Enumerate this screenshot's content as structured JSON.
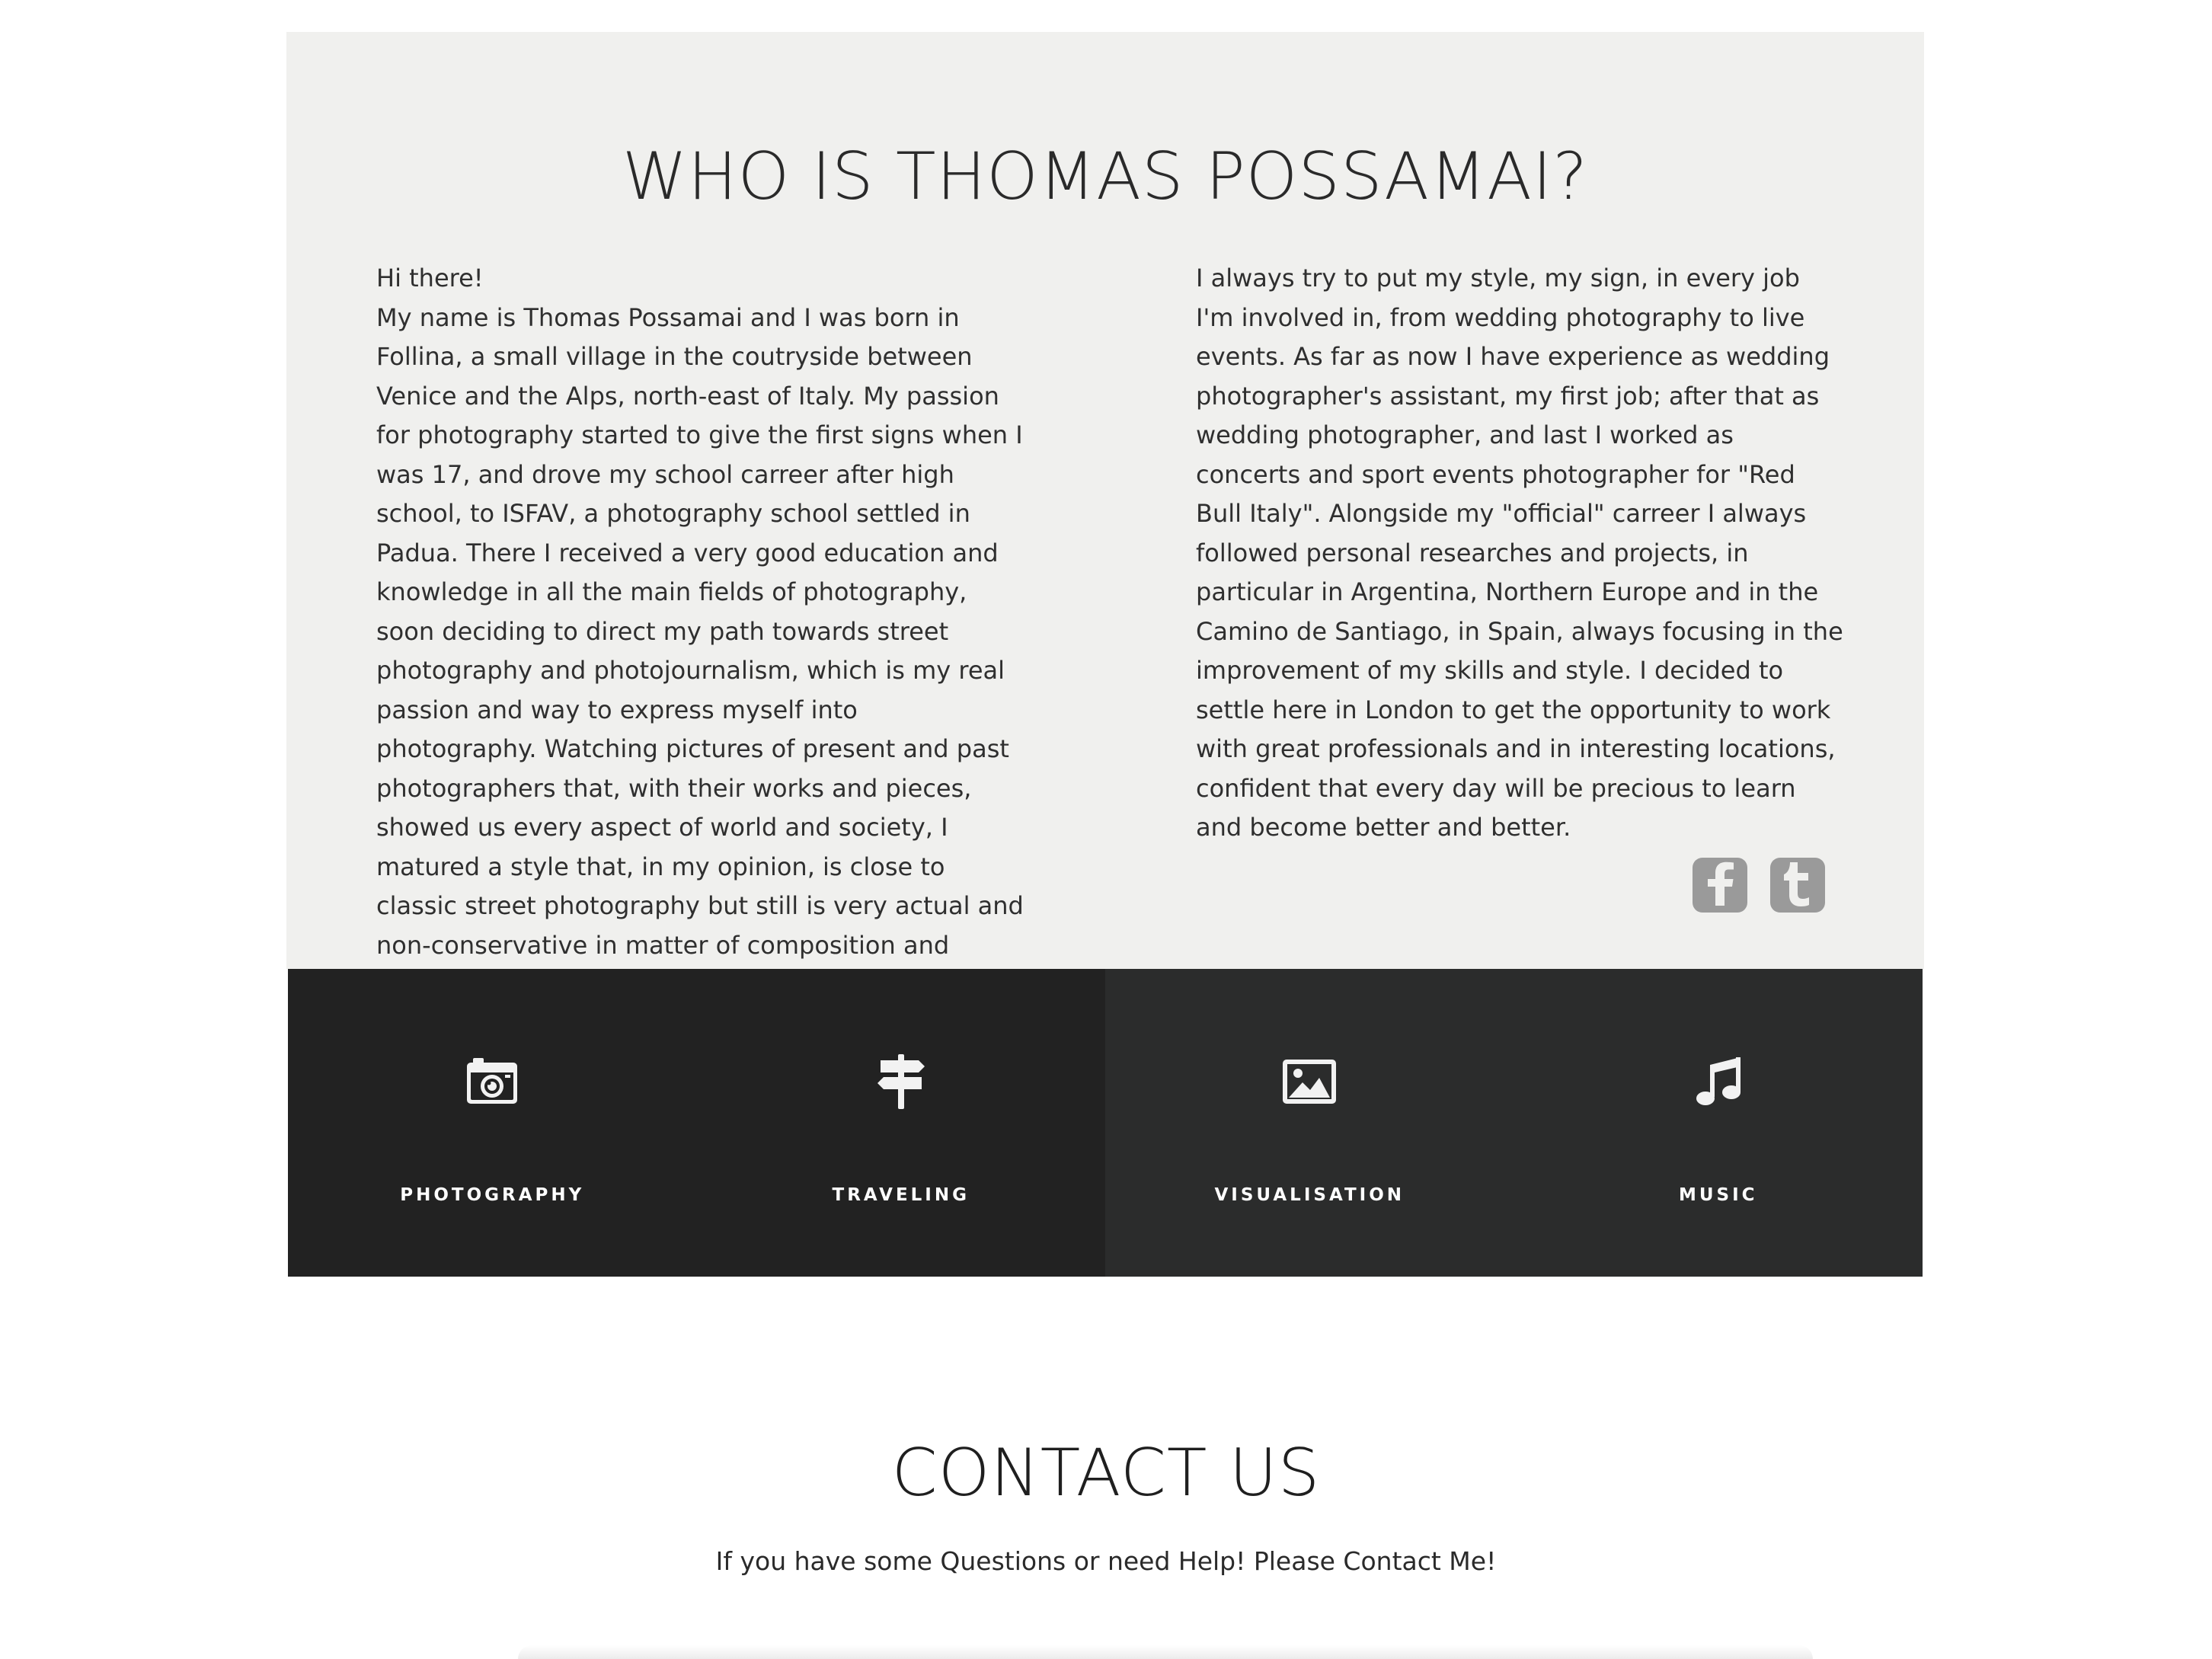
{
  "about": {
    "title": "WHO IS THOMAS POSSAMAI?",
    "left_text": "Hi there!\nMy name is Thomas Possamai and I was born in Follina, a small village in the coutryside between Venice and the Alps, north-east of Italy. My passion for photography started to give the first signs when I was 17, and drove my school carreer after high school, to ISFAV, a photography school settled in Padua. There I received a very good education and knowledge in all the main fields of photography, soon deciding to direct my path towards street photography and photojournalism, which is my real passion and way to express myself into photography. Watching pictures of present and past photographers that, with their works and pieces, showed us every aspect of world and society, I matured a style that, in my opinion, is close to classic street photography but still is very actual and non-conservative in matter of composition and choice of subjects.",
    "right_text": "I always try to put my style, my sign, in every job I'm involved in, from wedding photography to live events. As far as now I have experience as wedding photographer's assistant, my first job; after that as wedding photographer, and last I worked as concerts and sport events photographer for \"Red Bull Italy\". Alongside my \"official\" carreer I always followed personal researches and projects, in particular in Argentina, Northern Europe and in the Camino de Santiago, in Spain, always focusing in the improvement of my skills and style. I decided to settle here in London to get the opportunity to work with great professionals and in interesting locations, confident that every day will be precious to learn and become better and better.",
    "social": [
      {
        "icon": "facebook-icon"
      },
      {
        "icon": "tumblr-icon"
      }
    ]
  },
  "services": [
    {
      "label": "PHOTOGRAPHY",
      "icon": "camera-icon"
    },
    {
      "label": "TRAVELING",
      "icon": "signpost-icon"
    },
    {
      "label": "VISUALISATION",
      "icon": "image-icon"
    },
    {
      "label": "MUSIC",
      "icon": "music-note-icon"
    }
  ],
  "contact": {
    "title": "CONTACT US",
    "subtitle": "If you have some Questions or need Help! Please Contact Me!"
  },
  "colors": {
    "about_bg": "#f0f0ee",
    "services_dark": "#222222",
    "services_darker_alt": "#2b2c2c",
    "social_gray": "#9a9a9a"
  }
}
